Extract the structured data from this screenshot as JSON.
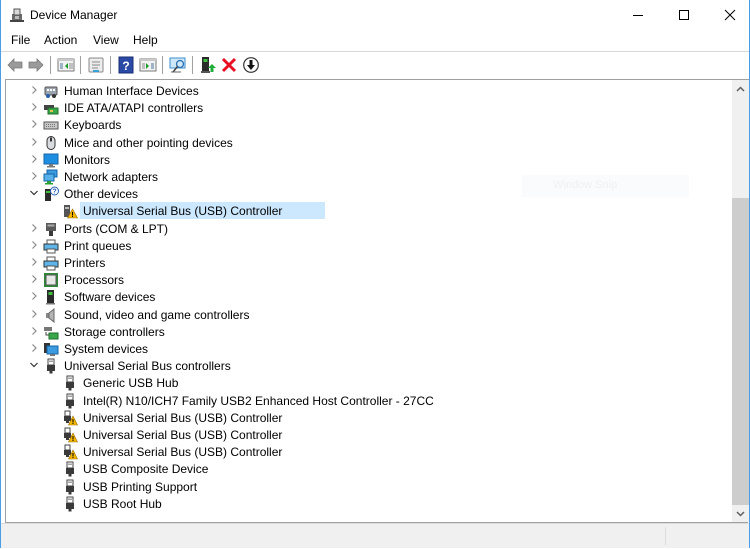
{
  "window": {
    "title": "Device Manager",
    "controls": [
      "minimize",
      "maximize",
      "close"
    ]
  },
  "menu": [
    {
      "label": "File"
    },
    {
      "label": "Action"
    },
    {
      "label": "View"
    },
    {
      "label": "Help"
    }
  ],
  "toolbar": [
    {
      "name": "back-icon",
      "tooltip": "Back"
    },
    {
      "name": "forward-icon",
      "tooltip": "Forward"
    },
    {
      "name": "show-hide-console-tree-icon",
      "tooltip": "Show/Hide Console Tree"
    },
    {
      "name": "properties-icon",
      "tooltip": "Properties"
    },
    {
      "name": "help-icon",
      "tooltip": "Help"
    },
    {
      "name": "show-hide-action-pane-icon",
      "tooltip": "Show/Hide Action Pane"
    },
    {
      "name": "scan-hardware-icon",
      "tooltip": "Scan for hardware changes"
    },
    {
      "name": "update-driver-icon",
      "tooltip": "Update driver"
    },
    {
      "name": "uninstall-device-icon",
      "tooltip": "Uninstall device"
    },
    {
      "name": "disable-device-icon",
      "tooltip": "Disable device"
    }
  ],
  "tree": {
    "items": [
      {
        "label": "Human Interface Devices",
        "icon": "hid-icon",
        "expanded": false
      },
      {
        "label": "IDE ATA/ATAPI controllers",
        "icon": "ide-controller-icon",
        "expanded": false
      },
      {
        "label": "Keyboards",
        "icon": "keyboard-icon",
        "expanded": false
      },
      {
        "label": "Mice and other pointing devices",
        "icon": "mouse-icon",
        "expanded": false
      },
      {
        "label": "Monitors",
        "icon": "monitor-icon",
        "expanded": false
      },
      {
        "label": "Network adapters",
        "icon": "network-adapter-icon",
        "expanded": false
      },
      {
        "label": "Other devices",
        "icon": "unknown-device-icon",
        "expanded": true,
        "children": [
          {
            "label": "Universal Serial Bus (USB) Controller",
            "icon": "warning-device-icon",
            "selected": true,
            "status": "warning"
          }
        ]
      },
      {
        "label": "Ports (COM & LPT)",
        "icon": "port-icon",
        "expanded": false
      },
      {
        "label": "Print queues",
        "icon": "printer-icon",
        "expanded": false
      },
      {
        "label": "Printers",
        "icon": "printer-icon",
        "expanded": false
      },
      {
        "label": "Processors",
        "icon": "processor-icon",
        "expanded": false
      },
      {
        "label": "Software devices",
        "icon": "software-device-icon",
        "expanded": false
      },
      {
        "label": "Sound, video and game controllers",
        "icon": "speaker-icon",
        "expanded": false
      },
      {
        "label": "Storage controllers",
        "icon": "storage-controller-icon",
        "expanded": false
      },
      {
        "label": "System devices",
        "icon": "system-device-icon",
        "expanded": false
      },
      {
        "label": "Universal Serial Bus controllers",
        "icon": "usb-icon",
        "expanded": true,
        "children": [
          {
            "label": "Generic USB Hub",
            "icon": "usb-icon",
            "status": "ok"
          },
          {
            "label": "Intel(R) N10/ICH7 Family USB2 Enhanced Host Controller - 27CC",
            "icon": "usb-icon",
            "status": "ok"
          },
          {
            "label": "Universal Serial Bus (USB) Controller",
            "icon": "usb-warning-icon",
            "status": "warning"
          },
          {
            "label": "Universal Serial Bus (USB) Controller",
            "icon": "usb-warning-icon",
            "status": "warning"
          },
          {
            "label": "Universal Serial Bus (USB) Controller",
            "icon": "usb-warning-icon",
            "status": "warning"
          },
          {
            "label": "USB Composite Device",
            "icon": "usb-icon",
            "status": "ok"
          },
          {
            "label": "USB Printing Support",
            "icon": "usb-icon",
            "status": "ok"
          },
          {
            "label": "USB Root Hub",
            "icon": "usb-icon",
            "status": "ok"
          }
        ]
      }
    ]
  },
  "overlay": {
    "label": "Window Snip"
  },
  "colors": {
    "selection": "#cce8ff",
    "window_border": "#4a9ee6",
    "warning": "#f5b800",
    "error_x": "#e81123"
  }
}
